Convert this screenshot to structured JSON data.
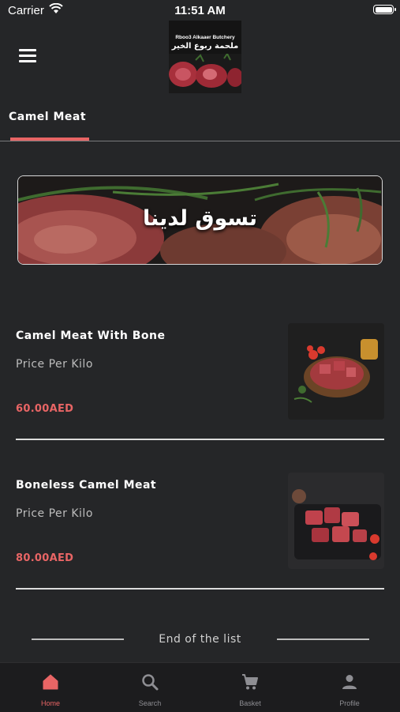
{
  "status_bar": {
    "carrier": "Carrier",
    "time": "11:51 AM",
    "battery_level": 1.0
  },
  "header": {
    "logo": {
      "name_en": "Rboo3 Alkaaer Butchery",
      "name_ar": "ملحمة ربوع الخير"
    }
  },
  "tabs": [
    {
      "label": "Camel Meat",
      "active": true
    }
  ],
  "banner": {
    "text": "تسوق لدينا"
  },
  "products": [
    {
      "name": "Camel Meat With Bone",
      "unit": "Price Per Kilo",
      "price": "60.00AED"
    },
    {
      "name": "Boneless Camel Meat",
      "unit": "Price Per Kilo",
      "price": "80.00AED"
    }
  ],
  "list_end": {
    "text": "End of the list"
  },
  "bottom_nav": [
    {
      "label": "Home",
      "icon": "home-icon",
      "active": true
    },
    {
      "label": "Search",
      "icon": "search-icon",
      "active": false
    },
    {
      "label": "Basket",
      "icon": "cart-icon",
      "active": false
    },
    {
      "label": "Profile",
      "icon": "person-icon",
      "active": false
    }
  ],
  "colors": {
    "accent": "#e86565",
    "background": "#252628",
    "nav_background": "#1c1c1e",
    "inactive": "#8e8e93"
  }
}
